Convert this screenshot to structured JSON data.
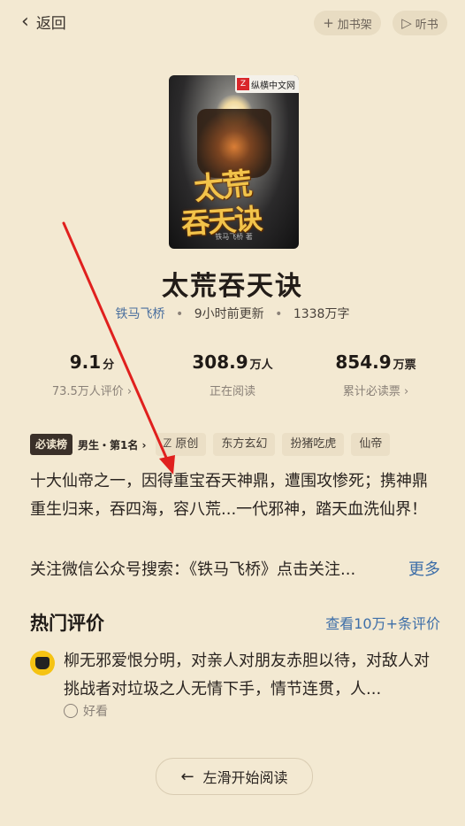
{
  "topbar": {
    "back_label": "返回",
    "add_shelf_label": "加书架",
    "listen_label": "听书"
  },
  "book": {
    "title": "太荒吞天诀",
    "cover": {
      "publisher": "纵横中文网",
      "title_line1": "太荒",
      "title_line2": "吞天诀",
      "author_small": "铁马飞桥 著"
    },
    "author": "铁马飞桥",
    "updated": "9小时前更新",
    "word_count": "1338万字"
  },
  "stats": [
    {
      "value": "9.1",
      "unit": "分",
      "label": "73.5万人评价 ›"
    },
    {
      "value": "308.9",
      "unit": "万人",
      "label": "正在阅读"
    },
    {
      "value": "854.9",
      "unit": "万票",
      "label": "累计必读票 ›"
    }
  ],
  "tags": {
    "rank_badge": "必读榜",
    "rank_text": "男生・第1名 ›",
    "items": [
      "原创",
      "东方玄幻",
      "扮猪吃虎",
      "仙帝"
    ]
  },
  "description": "十大仙帝之一，因得重宝吞天神鼎，遭围攻惨死；携神鼎重生归来，吞四海，容八荒...一代邪神，踏天血洗仙界！",
  "follow_text": "关注微信公众号搜索：《铁马飞桥》点击关注...",
  "more_label": "更多",
  "reviews": {
    "title": "热门评价",
    "view_all": "查看10万+条评价",
    "first": {
      "text": "柳无邪爱恨分明，对亲人对朋友赤胆以待，对敌人对挑战者对垃圾之人无情下手，情节连贯，人...",
      "like_label": "好看"
    }
  },
  "start_reading_label": "左滑开始阅读",
  "colors": {
    "background": "#f3e9d2",
    "link": "#3d6ea8",
    "annotation_arrow": "#e0201e"
  }
}
